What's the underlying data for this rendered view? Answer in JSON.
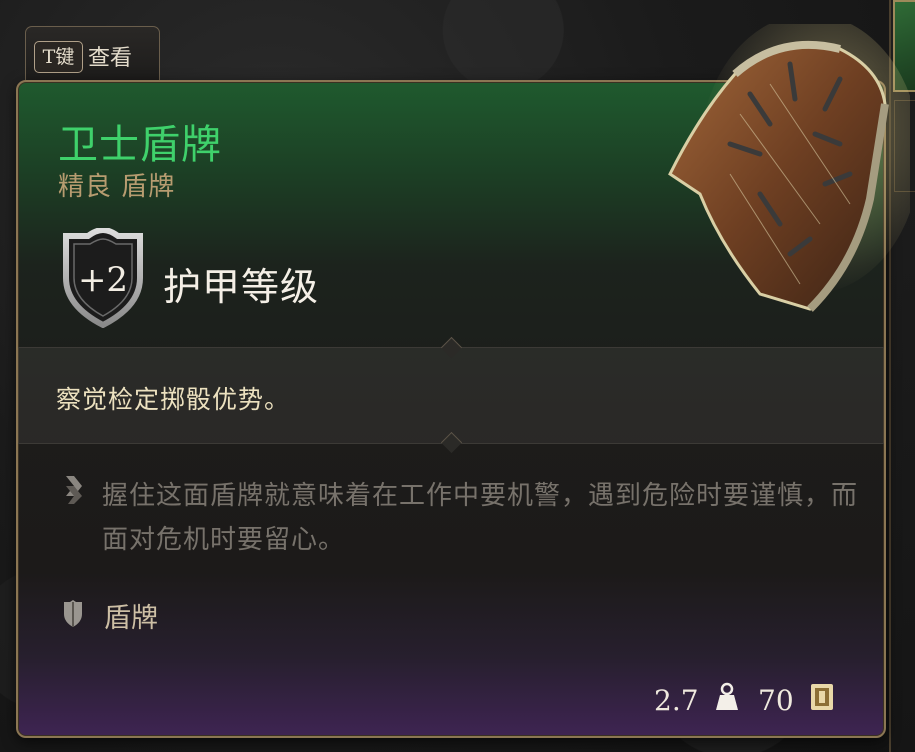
{
  "hint": {
    "key": "T键",
    "label": "查看"
  },
  "item": {
    "name": "卫士盾牌",
    "rarity_type": "精良 盾牌",
    "ac_value": "+2",
    "ac_label": "护甲等级",
    "effect": "察觉检定掷骰优势。",
    "lore": "握住这面盾牌就意味着在工作中要机警，遇到危险时要谨慎，而面对危机时要留心。",
    "category": "盾牌",
    "weight": "2.7",
    "price": "70"
  },
  "icons": {
    "lore": "scroll-icon",
    "category": "shield-category-icon",
    "weight": "weight-icon",
    "price": "gold-coin-icon"
  },
  "colors": {
    "name": "#3fd16b",
    "rarity": "#b79c70",
    "border": "#8b7653"
  }
}
